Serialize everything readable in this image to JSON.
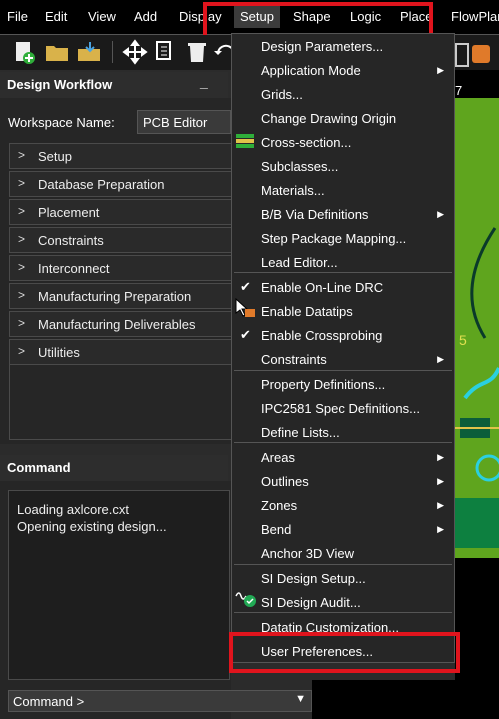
{
  "menubar": {
    "items": [
      "File",
      "Edit",
      "View",
      "Add",
      "Display",
      "Setup",
      "Shape",
      "Logic",
      "Place",
      "FlowPlan"
    ],
    "selected": "Setup"
  },
  "workflow": {
    "title": "Design Workflow",
    "workspace_label": "Workspace Name:",
    "workspace_value": "PCB Editor",
    "items": [
      "Setup",
      "Database Preparation",
      "Placement",
      "Constraints",
      "Interconnect",
      "Manufacturing Preparation",
      "Manufacturing Deliverables",
      "Utilities"
    ]
  },
  "command": {
    "title": "Command",
    "lines": [
      "Loading axlcore.cxt",
      "Opening existing design..."
    ],
    "prompt": "Command >"
  },
  "setup_menu": {
    "items": [
      {
        "label": "Design Parameters...",
        "arrow": false
      },
      {
        "label": "Application Mode",
        "arrow": true
      },
      {
        "label": "Grids...",
        "arrow": false
      },
      {
        "label": "Change Drawing Origin",
        "arrow": false
      },
      {
        "label": "Cross-section...",
        "arrow": false
      },
      {
        "label": "Subclasses...",
        "arrow": false
      },
      {
        "label": "Materials...",
        "arrow": false
      },
      {
        "label": "B/B Via Definitions",
        "arrow": true
      },
      {
        "label": "Step Package Mapping...",
        "arrow": false
      },
      {
        "label": "Lead Editor...",
        "arrow": false
      },
      {
        "label": "Enable On-Line DRC",
        "arrow": false,
        "checked": true
      },
      {
        "label": "Enable Datatips",
        "arrow": false
      },
      {
        "label": "Enable Crossprobing",
        "arrow": false,
        "checked": true
      },
      {
        "label": "Constraints",
        "arrow": true
      },
      {
        "label": "Property Definitions...",
        "arrow": false
      },
      {
        "label": "IPC2581 Spec Definitions...",
        "arrow": false
      },
      {
        "label": "Define Lists...",
        "arrow": false
      },
      {
        "label": "Areas",
        "arrow": true
      },
      {
        "label": "Outlines",
        "arrow": true
      },
      {
        "label": "Zones",
        "arrow": true
      },
      {
        "label": "Bend",
        "arrow": true
      },
      {
        "label": "Anchor 3D View",
        "arrow": false
      },
      {
        "label": "SI Design Setup...",
        "arrow": false
      },
      {
        "label": "SI Design Audit...",
        "arrow": false
      },
      {
        "label": "Datatip Customization...",
        "arrow": false
      },
      {
        "label": "User Preferences...",
        "arrow": false
      }
    ]
  },
  "canvas": {
    "label_7": "7",
    "label_5": "5"
  },
  "colors": {
    "highlight": "#e0141d",
    "pcb_green": "#5fa51e",
    "check_green": "#22aa55"
  }
}
